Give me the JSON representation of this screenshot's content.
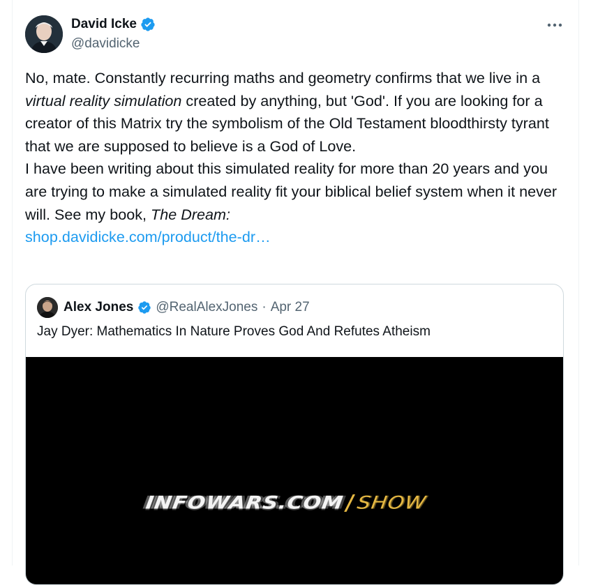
{
  "tweet": {
    "author_name": "David Icke",
    "author_handle": "@davidicke",
    "text_parts": {
      "p1_a": "No, mate. Constantly recurring maths and geometry confirms that we live in a ",
      "p1_em": "virtual reality simulation",
      "p1_b": " created by anything, but 'God'. If you are looking for a creator of this Matrix try the symbolism of the Old Testament bloodthirsty tyrant that we are supposed to believe is a God of Love.",
      "p2_a": "I have been writing about this simulated reality for more than 20 years and you are trying to make a simulated reality fit your biblical belief system when it never will. See my book, ",
      "p2_em": "The Dream:",
      "link": "shop.davidicke.com/product/the-dr…"
    }
  },
  "quote": {
    "author_name": "Alex Jones",
    "author_handle": "@RealAlexJones",
    "separator": "·",
    "date": "Apr 27",
    "text": "Jay Dyer: Mathematics In Nature Proves God And Refutes Atheism",
    "media_logo": {
      "main": "INFOWARS.COM",
      "separator": "/",
      "show": "SHOW"
    }
  },
  "colors": {
    "link": "#1d9bf0",
    "verified": "#1d9bf0",
    "secondary_text": "#536471",
    "logo_accent": "#e5b843"
  },
  "icons": [
    "verified-badge-icon",
    "more-options-icon"
  ]
}
